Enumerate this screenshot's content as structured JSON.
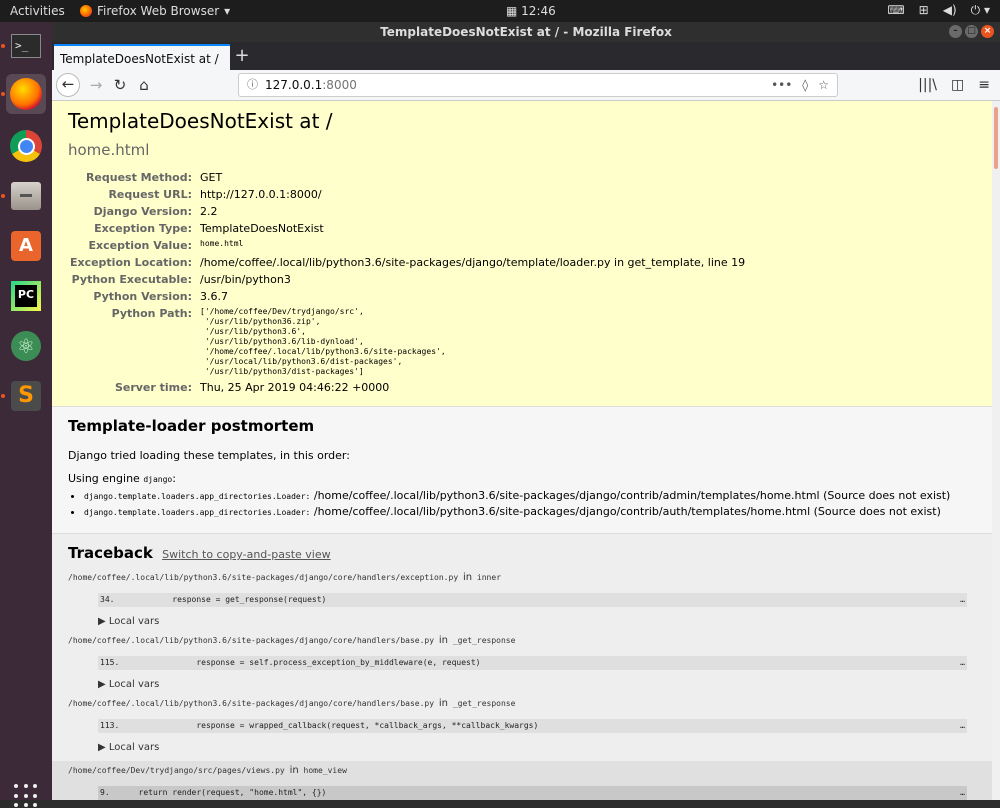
{
  "topbar": {
    "activities": "Activities",
    "app_name": "Firefox Web Browser",
    "app_menu_arrow": "▾",
    "clock": "12:46",
    "clock_icon": "calendar-icon",
    "tray_icons": [
      "keyboard-icon",
      "network-icon",
      "volume-icon",
      "power-icon"
    ]
  },
  "dock": {
    "items": [
      "terminal",
      "firefox",
      "chrome",
      "files",
      "software-center",
      "pycharm",
      "atom",
      "sublime-text"
    ],
    "show_apps_icon": "app-grid-icon"
  },
  "window": {
    "title": "TemplateDoesNotExist at / - Mozilla Firefox",
    "tab_title": "TemplateDoesNotExist at /",
    "new_tab": "+",
    "url_host": "127.0.0.1",
    "url_port": ":8000",
    "url_more": "•••"
  },
  "summary": {
    "heading": "TemplateDoesNotExist at /",
    "subheading": "home.html",
    "rows": [
      {
        "label": "Request Method:",
        "value": "GET"
      },
      {
        "label": "Request URL:",
        "value": "http://127.0.0.1:8000/"
      },
      {
        "label": "Django Version:",
        "value": "2.2"
      },
      {
        "label": "Exception Type:",
        "value": "TemplateDoesNotExist"
      },
      {
        "label": "Exception Value:",
        "value": "home.html"
      },
      {
        "label": "Exception Location:",
        "value": "/home/coffee/.local/lib/python3.6/site-packages/django/template/loader.py in get_template, line 19"
      },
      {
        "label": "Python Executable:",
        "value": "/usr/bin/python3"
      },
      {
        "label": "Python Version:",
        "value": "3.6.7"
      },
      {
        "label": "Python Path:",
        "value": ""
      },
      {
        "label": "Server time:",
        "value": "Thu, 25 Apr 2019 04:46:22 +0000"
      }
    ],
    "python_path": [
      "['/home/coffee/Dev/trydjango/src',",
      " '/usr/lib/python36.zip',",
      " '/usr/lib/python3.6',",
      " '/usr/lib/python3.6/lib-dynload',",
      " '/home/coffee/.local/lib/python3.6/site-packages',",
      " '/usr/local/lib/python3.6/dist-packages',",
      " '/usr/lib/python3/dist-packages']"
    ]
  },
  "postmortem": {
    "heading": "Template-loader postmortem",
    "intro": "Django tried loading these templates, in this order:",
    "engine_prefix": "Using engine ",
    "engine_name": "django",
    "engine_suffix": ":",
    "items": [
      {
        "loader": "django.template.loaders.app_directories.Loader:",
        "path": " /home/coffee/.local/lib/python3.6/site-packages/django/contrib/admin/templates/home.html (Source does not exist)"
      },
      {
        "loader": "django.template.loaders.app_directories.Loader:",
        "path": " /home/coffee/.local/lib/python3.6/site-packages/django/contrib/auth/templates/home.html (Source does not exist)"
      }
    ]
  },
  "traceback": {
    "heading": "Traceback",
    "switch_link": "Switch to copy-and-paste view",
    "local_vars_label": "▶ Local vars",
    "in_word": "in",
    "ellipsis": "…",
    "frames": [
      {
        "file": "/home/coffee/.local/lib/python3.6/site-packages/django/core/handlers/exception.py",
        "func": "inner",
        "code": "34.            response = get_response(request)",
        "user": false
      },
      {
        "file": "/home/coffee/.local/lib/python3.6/site-packages/django/core/handlers/base.py",
        "func": "_get_response",
        "code": "115.                response = self.process_exception_by_middleware(e, request)",
        "user": false
      },
      {
        "file": "/home/coffee/.local/lib/python3.6/site-packages/django/core/handlers/base.py",
        "func": "_get_response",
        "code": "113.                response = wrapped_callback(request, *callback_args, **callback_kwargs)",
        "user": false
      },
      {
        "file": "/home/coffee/Dev/trydjango/src/pages/views.py",
        "func": "home_view",
        "code": "9.      return render(request, \"home.html\", {})",
        "user": true
      }
    ]
  }
}
